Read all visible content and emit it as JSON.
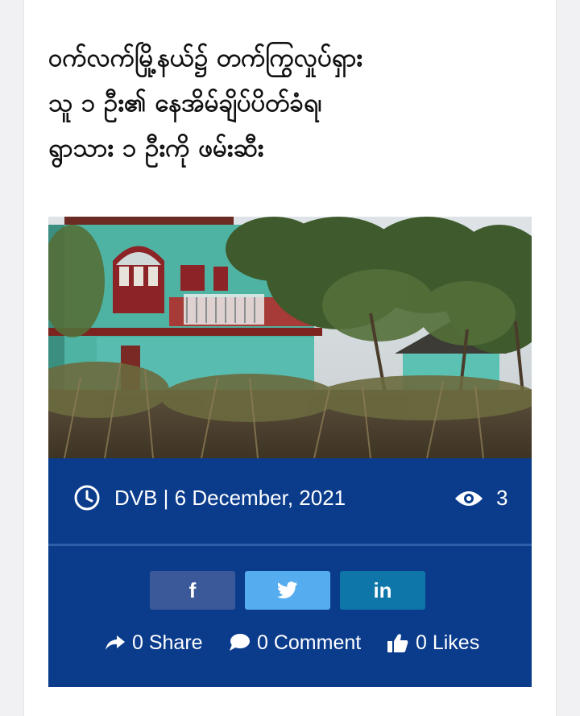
{
  "article": {
    "title_line1": "ဝက်လက်မြို့နယ်၌ တက်ကြွလှုပ်ရှား",
    "title_line2": "သူ ၁ ဦး၏ နေအိမ်ချိပ်ပိတ်ခံရ၊",
    "title_line3": "ရွာသား ၁ ဦးကို ဖမ်းဆီး",
    "byline": "DVB | 6 December, 2021",
    "views": "3"
  },
  "share_buttons": [
    {
      "network": "facebook",
      "label": "f",
      "color": "#3b5998"
    },
    {
      "network": "twitter",
      "label": "",
      "color": "#55acee"
    },
    {
      "network": "linkedin",
      "label": "in",
      "color": "#0e76a8"
    }
  ],
  "stats": {
    "share": "0 Share",
    "comment": "0 Comment",
    "likes": "0 Likes"
  },
  "icons": {
    "clock": "clock-icon",
    "views": "eye-icon",
    "share": "share-arrow-icon",
    "comment": "comment-bubble-icon",
    "likes": "thumbs-up-icon"
  },
  "colors": {
    "panel": "#0b3c8c",
    "divider": "#2e5ea8",
    "title": "#111111"
  }
}
